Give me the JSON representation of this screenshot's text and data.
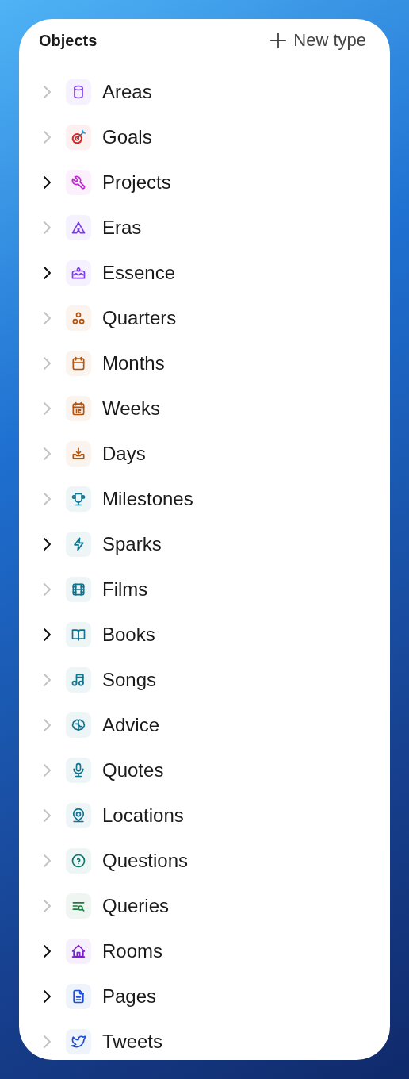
{
  "header": {
    "title": "Objects",
    "new_button": {
      "label": "New type"
    }
  },
  "items": [
    {
      "label": "Areas",
      "kind": "cylinder",
      "color": "#7c3aed",
      "has_children": false
    },
    {
      "label": "Goals",
      "kind": "target",
      "color": "#dc2626",
      "has_children": false
    },
    {
      "label": "Projects",
      "kind": "wrench",
      "color": "#c026d3",
      "has_children": true
    },
    {
      "label": "Eras",
      "kind": "tent",
      "color": "#7c3aed",
      "has_children": false
    },
    {
      "label": "Essence",
      "kind": "cake",
      "color": "#7c3aed",
      "has_children": true
    },
    {
      "label": "Quarters",
      "kind": "circles",
      "color": "#b45309",
      "has_children": false
    },
    {
      "label": "Months",
      "kind": "calendar",
      "color": "#b45309",
      "has_children": false
    },
    {
      "label": "Weeks",
      "kind": "calendar-day",
      "color": "#b45309",
      "has_children": false
    },
    {
      "label": "Days",
      "kind": "tray",
      "color": "#b45309",
      "has_children": false
    },
    {
      "label": "Milestones",
      "kind": "trophy",
      "color": "#0e7490",
      "has_children": false
    },
    {
      "label": "Sparks",
      "kind": "bolt",
      "color": "#0e7490",
      "has_children": true
    },
    {
      "label": "Films",
      "kind": "film",
      "color": "#0e7490",
      "has_children": false
    },
    {
      "label": "Books",
      "kind": "book",
      "color": "#0e7490",
      "has_children": true
    },
    {
      "label": "Songs",
      "kind": "music",
      "color": "#0e7490",
      "has_children": false
    },
    {
      "label": "Advice",
      "kind": "brain",
      "color": "#0e7490",
      "has_children": false
    },
    {
      "label": "Quotes",
      "kind": "mic",
      "color": "#0e7490",
      "has_children": false
    },
    {
      "label": "Locations",
      "kind": "pin",
      "color": "#0e7490",
      "has_children": false
    },
    {
      "label": "Questions",
      "kind": "question",
      "color": "#0f766e",
      "has_children": false
    },
    {
      "label": "Queries",
      "kind": "list-search",
      "color": "#15803d",
      "has_children": false
    },
    {
      "label": "Rooms",
      "kind": "home",
      "color": "#7e22ce",
      "has_children": true
    },
    {
      "label": "Pages",
      "kind": "file",
      "color": "#1d4ed8",
      "has_children": true
    },
    {
      "label": "Tweets",
      "kind": "bird",
      "color": "#1d4ed8",
      "has_children": false
    }
  ]
}
